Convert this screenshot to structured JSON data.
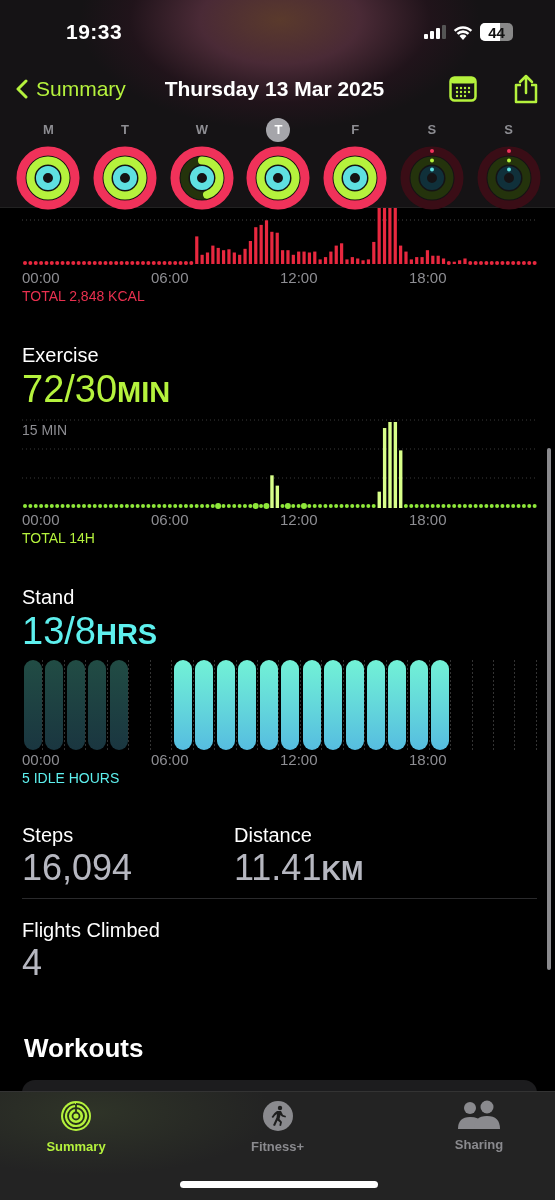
{
  "status_bar": {
    "time": "19:33",
    "battery": "44"
  },
  "nav": {
    "back": "Summary",
    "title": "Thursday 13 Mar 2025"
  },
  "days": [
    {
      "letter": "M",
      "selected": false,
      "rings": [
        {
          "kind": "move"
        },
        {
          "kind": "exercise"
        },
        {
          "kind": "stand"
        }
      ]
    },
    {
      "letter": "T",
      "selected": false,
      "rings": [
        {
          "kind": "move"
        },
        {
          "kind": "exercise"
        },
        {
          "kind": "stand"
        }
      ]
    },
    {
      "letter": "W",
      "selected": false,
      "rings": [
        {
          "kind": "move"
        },
        {
          "kind": "exercise"
        },
        {
          "kind": "stand"
        }
      ]
    },
    {
      "letter": "T",
      "selected": true,
      "rings": [
        {
          "kind": "move"
        },
        {
          "kind": "exercise"
        },
        {
          "kind": "stand"
        }
      ]
    },
    {
      "letter": "F",
      "selected": false,
      "rings": [
        {
          "kind": "move"
        },
        {
          "kind": "exercise"
        },
        {
          "kind": "stand"
        }
      ]
    },
    {
      "letter": "S",
      "selected": false,
      "rings": [
        {
          "kind": "move"
        },
        {
          "kind": "exercise"
        },
        {
          "kind": "stand"
        }
      ]
    },
    {
      "letter": "S",
      "selected": false,
      "rings": [
        {
          "kind": "move"
        },
        {
          "kind": "exercise"
        },
        {
          "kind": "stand"
        }
      ]
    }
  ],
  "move": {
    "axis_labels": [
      "00:00",
      "06:00",
      "12:00",
      "18:00"
    ],
    "total": "TOTAL 2,848 KCAL"
  },
  "exercise": {
    "title": "Exercise",
    "value": "72/30",
    "unit": "MIN",
    "scale_label": "15 MIN",
    "axis_labels": [
      "00:00",
      "06:00",
      "12:00",
      "18:00"
    ],
    "total": "TOTAL 14H"
  },
  "stand": {
    "title": "Stand",
    "value": "13/8",
    "unit": "HRS",
    "hours": [
      {
        "kind": "dim"
      },
      {
        "kind": "dim"
      },
      {
        "kind": "dim"
      },
      {
        "kind": "dim"
      },
      {
        "kind": "dim"
      },
      {
        "kind": "none"
      },
      {
        "kind": "none"
      },
      {
        "kind": "bright"
      },
      {
        "kind": "bright"
      },
      {
        "kind": "bright"
      },
      {
        "kind": "bright"
      },
      {
        "kind": "bright"
      },
      {
        "kind": "bright"
      },
      {
        "kind": "bright"
      },
      {
        "kind": "bright"
      },
      {
        "kind": "bright"
      },
      {
        "kind": "bright"
      },
      {
        "kind": "bright"
      },
      {
        "kind": "bright"
      },
      {
        "kind": "bright"
      },
      {
        "kind": "none"
      },
      {
        "kind": "none"
      },
      {
        "kind": "none"
      },
      {
        "kind": "none"
      }
    ],
    "axis_labels": [
      "00:00",
      "06:00",
      "12:00",
      "18:00"
    ],
    "total": "5 IDLE HOURS"
  },
  "stats": [
    [
      {
        "label": "Steps",
        "value": "16,094"
      },
      {
        "label": "Distance",
        "value": "11.41",
        "unit": "KM"
      }
    ],
    [
      {
        "label": "Flights Climbed",
        "value": "4"
      }
    ]
  ],
  "workouts": {
    "title": "Workouts"
  },
  "tabs": [
    {
      "label": "Summary",
      "kind": "summary",
      "selected": true
    },
    {
      "label": "Fitness+",
      "kind": "fitness",
      "selected": false
    },
    {
      "label": "Sharing",
      "kind": "sharing",
      "selected": false
    }
  ]
}
